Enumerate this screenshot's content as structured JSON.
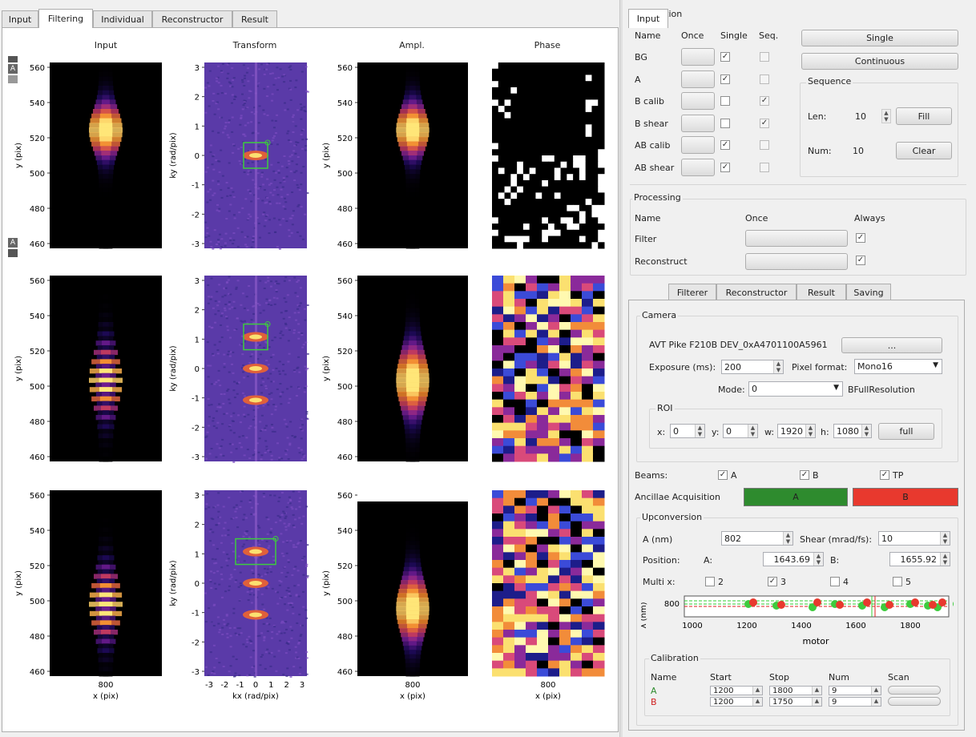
{
  "tabs": {
    "left": [
      "Input",
      "Filtering",
      "Individual",
      "Reconstructor",
      "Result"
    ],
    "active": "Filtering"
  },
  "plots": {
    "col_titles": [
      "Input",
      "Transform",
      "Ampl.",
      "Phase"
    ],
    "ylabel_pix": "y (pix)",
    "ylabel_k": "ky (rad/pix)",
    "xlabel_pix": "x (pix)",
    "xlabel_k": "kx (rad/pix)",
    "y_ticks_pix": [
      "560",
      "540",
      "520",
      "500",
      "480",
      "460"
    ],
    "y_ticks_k": [
      "3",
      "2",
      "1",
      "0",
      "-1",
      "-2",
      "-3"
    ],
    "x_ticks_pix": [
      "800"
    ],
    "x_ticks_k": [
      "-3",
      "-2",
      "-1",
      "0",
      "1",
      "2",
      "3"
    ],
    "toolbar_icons": [
      "A",
      "A"
    ]
  },
  "acquisition": {
    "title": "Acquisition",
    "headers": [
      "Name",
      "Once",
      "Single",
      "Seq."
    ],
    "rows": [
      {
        "name": "BG",
        "single": true,
        "seq": false
      },
      {
        "name": "A",
        "single": true,
        "seq": false
      },
      {
        "name": "B calib",
        "single": false,
        "seq": true
      },
      {
        "name": "B shear",
        "single": false,
        "seq": true
      },
      {
        "name": "AB calib",
        "single": true,
        "seq": false
      },
      {
        "name": "AB shear",
        "single": true,
        "seq": false
      }
    ],
    "single_btn": "Single",
    "continuous_btn": "Continuous",
    "sequence": {
      "title": "Sequence",
      "len_label": "Len:",
      "len_value": "10",
      "fill_btn": "Fill",
      "num_label": "Num:",
      "num_value": "10",
      "clear_btn": "Clear"
    }
  },
  "processing": {
    "title": "Processing",
    "headers": [
      "Name",
      "Once",
      "Always"
    ],
    "rows": [
      {
        "name": "Filter",
        "always": true
      },
      {
        "name": "Reconstruct",
        "always": true
      }
    ]
  },
  "right_tabs": {
    "items": [
      "Input",
      "Filterer",
      "Reconstructor",
      "Result",
      "Saving"
    ],
    "active": "Input"
  },
  "camera": {
    "title": "Camera",
    "device": "AVT Pike F210B DEV_0xA4701100A5961",
    "browse_btn": "...",
    "exposure_label": "Exposure (ms):",
    "exposure_value": "200",
    "pixfmt_label": "Pixel format:",
    "pixfmt_value": "Mono16",
    "mode_label": "Mode:",
    "mode_value": "0",
    "mode_extra": "BFullResolution",
    "roi": {
      "title": "ROI",
      "x_label": "x:",
      "x": "0",
      "y_label": "y:",
      "y": "0",
      "w_label": "w:",
      "w": "1920",
      "h_label": "h:",
      "h": "1080",
      "full_btn": "full"
    }
  },
  "beams": {
    "label": "Beams:",
    "items": [
      {
        "name": "A",
        "checked": true
      },
      {
        "name": "B",
        "checked": true
      },
      {
        "name": "TP",
        "checked": true
      }
    ]
  },
  "ancillae": {
    "label": "Ancillae Acquisition",
    "a_btn": "A",
    "b_btn": "B",
    "a_color": "#2e8b2e",
    "b_color": "#e8392e"
  },
  "upconversion": {
    "title": "Upconversion",
    "a_label": "A (nm)",
    "a_value": "802",
    "shear_label": "Shear (mrad/fs):",
    "shear_value": "10",
    "position_label": "Position:",
    "pos_a_label": "A:",
    "pos_a": "1643.69",
    "pos_b_label": "B:",
    "pos_b": "1655.92",
    "multi_label": "Multi x:",
    "multi": [
      {
        "n": "2",
        "checked": false
      },
      {
        "n": "3",
        "checked": true
      },
      {
        "n": "4",
        "checked": false
      },
      {
        "n": "5",
        "checked": false
      }
    ],
    "mini_plot": {
      "ylabel": "λ (nm)",
      "xlabel": "motor",
      "y_tick": "800",
      "x_ticks": [
        "1000",
        "1200",
        "1400",
        "1600",
        "1800"
      ]
    }
  },
  "calibration": {
    "title": "Calibration",
    "headers": [
      "Name",
      "Start",
      "Stop",
      "Num",
      "Scan"
    ],
    "rows": [
      {
        "name": "A",
        "start": "1200",
        "stop": "1800",
        "num": "9",
        "color": "#2e8b2e"
      },
      {
        "name": "B",
        "start": "1200",
        "stop": "1750",
        "num": "9",
        "color": "#d02020"
      }
    ]
  }
}
